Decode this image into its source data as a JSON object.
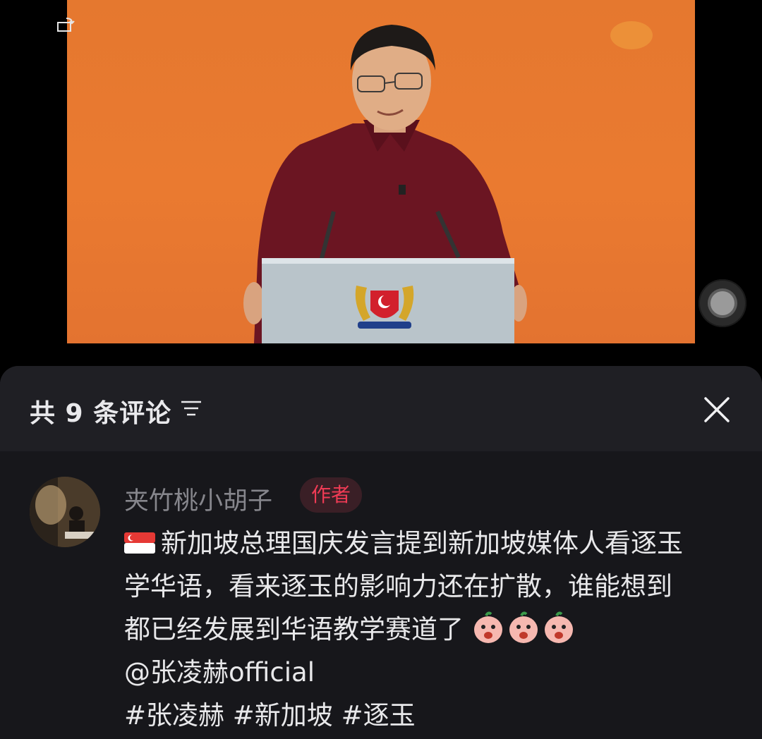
{
  "video": {
    "scene_description_icon": "speaker-at-podium-photo",
    "background_color": "#e8782f"
  },
  "comments_panel": {
    "count_label": "共 9 条评论",
    "filter_icon": "filter-icon",
    "close_icon": "close-icon"
  },
  "comment": {
    "username": "夹竹桃小胡子",
    "badge": "作者",
    "flag_icon": "singapore-flag-icon",
    "text_line1": "新加坡总理国庆发言提到新加坡媒体人看逐玉",
    "text_line2": "学华语，看来逐玉的影响力还在扩散，谁能想到",
    "text_line3": "都已经发展到华语教学赛道了",
    "mention": "@张凌赫official",
    "hashtags": [
      "#张凌赫",
      "#新加坡",
      "#逐玉"
    ],
    "emoji_icon": "peach-sticker-icon"
  }
}
